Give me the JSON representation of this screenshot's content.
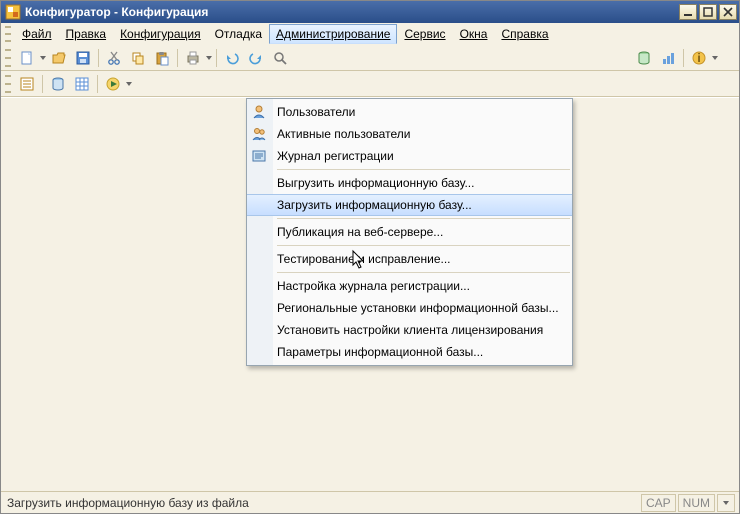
{
  "title": "Конфигуратор - Конфигурация",
  "menus": {
    "file": "Файл",
    "edit": "Правка",
    "config": "Конфигурация",
    "debug": "Отладка",
    "admin": "Администрирование",
    "service": "Сервис",
    "windows": "Окна",
    "help": "Справка"
  },
  "dropdown": {
    "users": "Пользователи",
    "active_users": "Активные пользователи",
    "event_log": "Журнал регистрации",
    "export_ib": "Выгрузить информационную базу...",
    "import_ib": "Загрузить информационную базу...",
    "publish": "Публикация на веб-сервере...",
    "test_fix": "Тестирование и исправление...",
    "log_setup": "Настройка журнала регистрации...",
    "regional": "Региональные установки информационной базы...",
    "license": "Установить настройки клиента лицензирования",
    "ib_params": "Параметры информационной базы..."
  },
  "status": {
    "text": "Загрузить информационную базу из файла",
    "cap": "CAP",
    "num": "NUM"
  }
}
